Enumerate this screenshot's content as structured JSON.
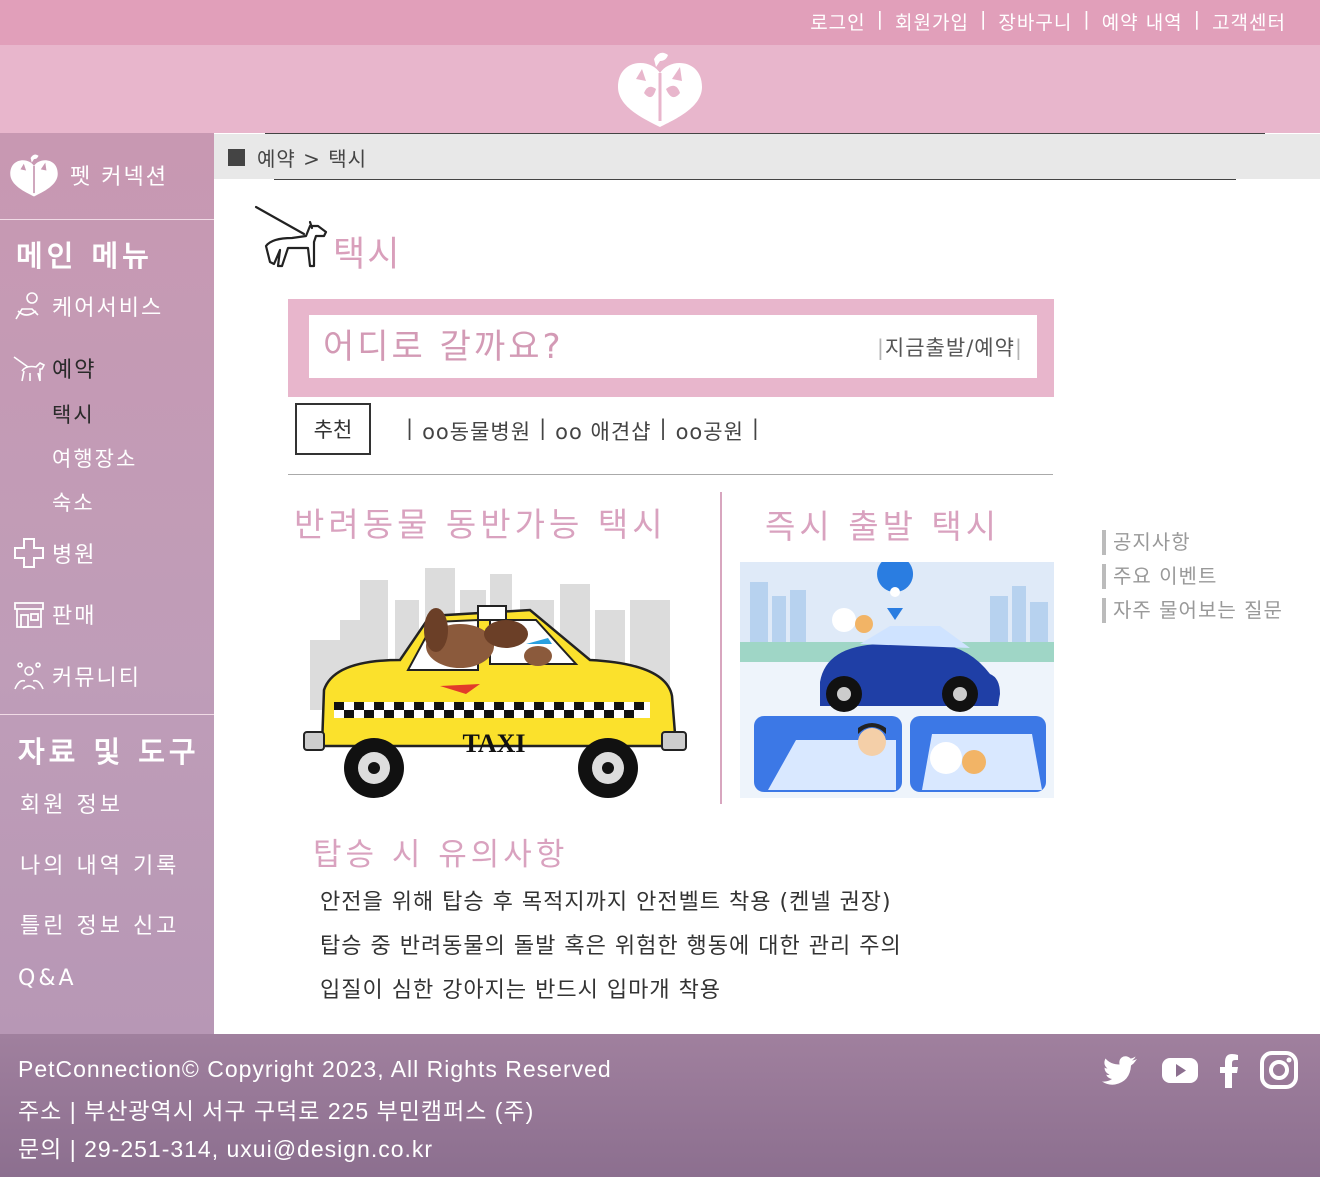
{
  "header": {
    "links": [
      "로그인",
      "회원가입",
      "장바구니",
      "예약 내역",
      "고객센터"
    ],
    "separator": "|"
  },
  "sidebar": {
    "brand": "펫 커넥션",
    "main_menu_title": "메인 메뉴",
    "items": [
      {
        "label": "케어서비스",
        "icon": "hand-pet-icon"
      },
      {
        "label": "예약",
        "icon": "dog-walk-icon"
      },
      {
        "label": "병원",
        "icon": "medical-cross-icon"
      },
      {
        "label": "판매",
        "icon": "store-icon"
      },
      {
        "label": "커뮤니티",
        "icon": "community-icon"
      }
    ],
    "sub_items": [
      "택시",
      "여행장소",
      "숙소"
    ],
    "tools_title": "자료 및 도구",
    "tools": [
      "회원 정보",
      "나의 내역 기록",
      "틀린 정보 신고",
      "Q&A"
    ]
  },
  "breadcrumb": "예약 > 택시",
  "page_title": "택시",
  "search": {
    "placeholder": "어디로 갈까요?",
    "mode": "지금출발/예약"
  },
  "recommend": {
    "label": "추천",
    "items": [
      "oo동물병원",
      "oo 애견샵",
      "oo공원"
    ]
  },
  "sections": {
    "left_title": "반려동물 동반가능 택시",
    "right_title": "즉시 출발 택시",
    "taxi_sign": "TAXI"
  },
  "notes": {
    "title": "탑승 시 유의사항",
    "lines": [
      "안전을 위해 탑승 후 목적지까지 안전벨트 착용 (켄넬 권장)",
      "탑승 중 반려동물의 돌발 혹은 위험한 행동에 대한 관리 주의",
      "입질이 심한 강아지는 반드시 입마개 착용"
    ]
  },
  "right_links": [
    "공지사항",
    "주요 이벤트",
    "자주 물어보는 질문"
  ],
  "footer": {
    "copyright": "PetConnection© Copyright 2023, All Rights Reserved",
    "address": "주소 | 부산광역시 서구 구덕로 225 부민캠퍼스 (주)",
    "contact": "문의 | 29-251-314, uxui@design.co.kr",
    "social": [
      "twitter-icon",
      "youtube-icon",
      "facebook-icon",
      "instagram-icon"
    ]
  },
  "colors": {
    "topbar": "#e19fba",
    "banner": "#e8b6cc",
    "sidebar": "#c898b2",
    "accent": "#d9a2bf",
    "footer": "#8c6f8f"
  }
}
